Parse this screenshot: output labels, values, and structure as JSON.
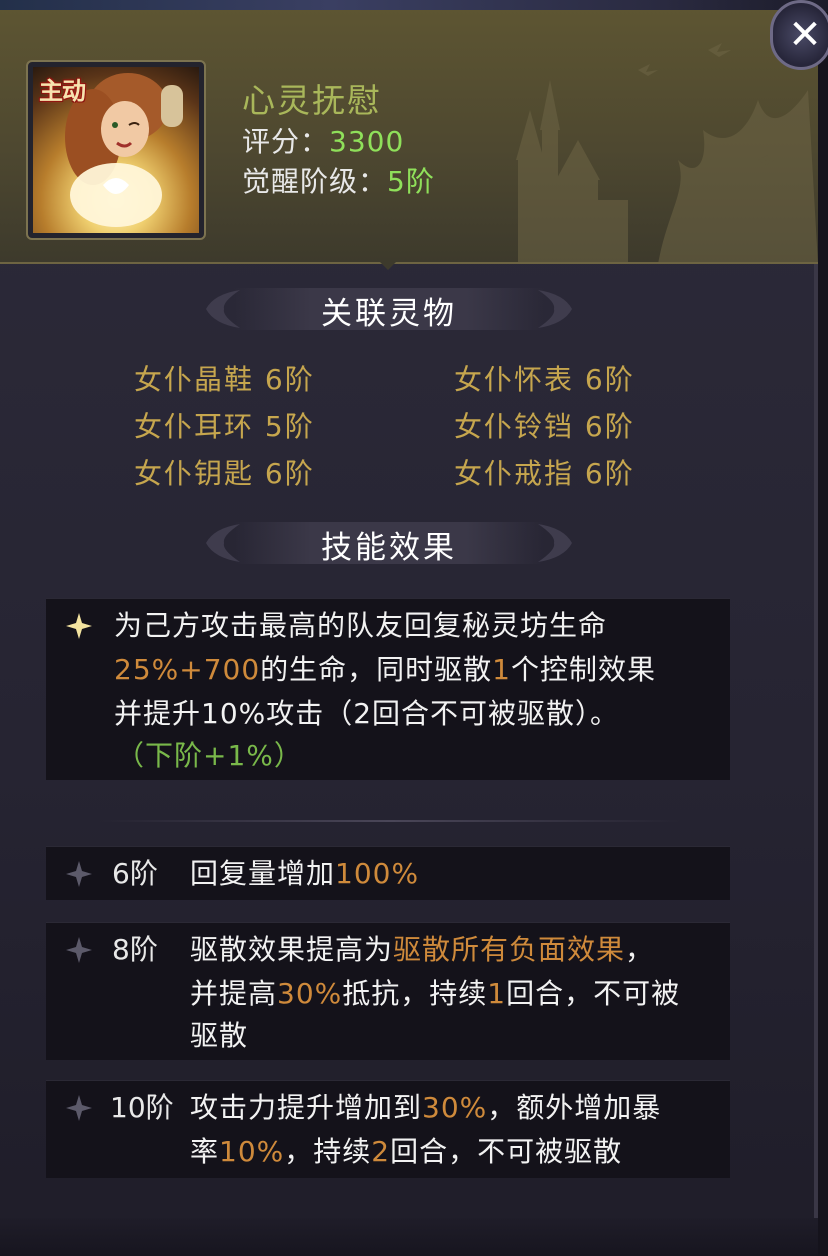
{
  "header": {
    "portrait_tag": "主动",
    "skill_name": "心灵抚慰",
    "score_label": "评分：",
    "score_value": "3300",
    "awaken_label": "觉醒阶级：",
    "awaken_value": "5阶"
  },
  "related": {
    "title": "关联灵物",
    "items": [
      "女仆晶鞋 6阶",
      "女仆怀表 6阶",
      "女仆耳环 5阶",
      "女仆铃铛 6阶",
      "女仆钥匙 6阶",
      "女仆戒指 6阶"
    ]
  },
  "effect": {
    "title": "技能效果",
    "main": {
      "line1": "为己方攻击最高的队友回复秘灵坊生命",
      "line2_a": "25%+700",
      "line2_b": "的生命，同时驱散",
      "line2_c": "1",
      "line2_d": "个控制效果",
      "line3": "并提升10%攻击（2回合不可被驱散）。",
      "line4": "（下阶+1%）"
    },
    "tiers": [
      {
        "level": "6阶",
        "a": "回复量增加",
        "b": "100%"
      },
      {
        "level": "8阶",
        "a": "驱散效果提高为",
        "b": "驱散所有负面效果",
        "c": "，",
        "d": "并提高",
        "e": "30%",
        "f": "抵抗，持续",
        "g": "1",
        "h": "回合，不可被",
        "i": "驱散"
      },
      {
        "level": "10阶",
        "a": "攻击力提升增加到",
        "b": "30%",
        "c": "，额外增加暴",
        "d": "率",
        "e": "10%",
        "f": "，持续",
        "g": "2",
        "h": "回合，不可被驱散"
      }
    ]
  },
  "icons": {
    "close": "close-icon",
    "bullet": "sparkle-icon"
  },
  "colors": {
    "accent_orange": "#cf8a3b",
    "accent_green": "#79b84a",
    "item_gold": "#c6a64e",
    "skill_name": "#a9b75a"
  }
}
